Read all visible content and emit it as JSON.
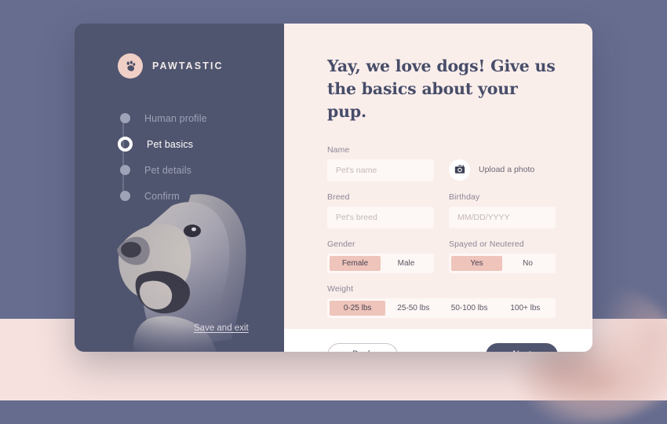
{
  "theme": {
    "page_bg_top": "#676d8f",
    "page_bg_bottom": "#f6e1de",
    "sidebar_bg": "#50556f",
    "panel_bg": "#faeeeb",
    "accent_pink": "#eec4bb",
    "logo_circle": "#f0cfc6",
    "footer_bg": "#ffffff"
  },
  "sidebar": {
    "brand_name": "PAWTASTIC",
    "brand_icon": "paw-print-icon",
    "steps": [
      {
        "label": "Human profile",
        "state": "incomplete"
      },
      {
        "label": "Pet basics",
        "state": "active"
      },
      {
        "label": "Pet details",
        "state": "incomplete"
      },
      {
        "label": "Confirm",
        "state": "incomplete"
      }
    ],
    "save_and_exit": "Save and exit",
    "photo_alt": "dog-photo"
  },
  "main": {
    "headline": "Yay, we love dogs! Give us the basics about your pup.",
    "fields": {
      "name": {
        "label": "Name",
        "value": "",
        "placeholder": "Pet's name"
      },
      "breed": {
        "label": "Breed",
        "value": "",
        "placeholder": "Pet's breed"
      },
      "birthday": {
        "label": "Birthday",
        "value": "",
        "placeholder": "MM/DD/YYYY"
      }
    },
    "upload": {
      "label": "Upload a photo",
      "icon": "camera-icon"
    },
    "gender": {
      "label": "Gender",
      "options": [
        "Female",
        "Male"
      ],
      "selected": "Female"
    },
    "spayed": {
      "label": "Spayed or Neutered",
      "options": [
        "Yes",
        "No"
      ],
      "selected": "Yes"
    },
    "weight": {
      "label": "Weight",
      "options": [
        "0-25 lbs",
        "25-50 lbs",
        "50-100 lbs",
        "100+ lbs"
      ],
      "selected": "0-25 lbs"
    }
  },
  "footer": {
    "back_label": "Back",
    "next_label": "Next"
  }
}
